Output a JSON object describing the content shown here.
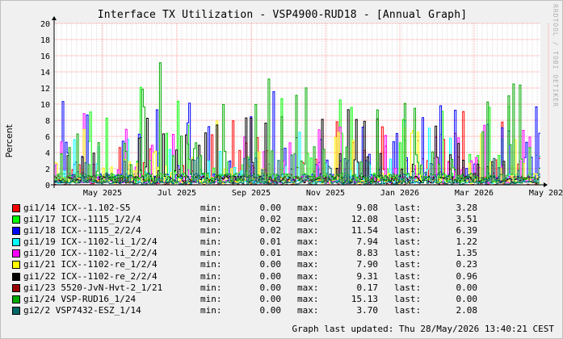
{
  "title": "Interface TX Utilization - VSP4900-RUD18 - [Annual Graph]",
  "watermark": "RRDTOOL / TOBI OETIKER",
  "ylabel": "Percent",
  "footer": "Graph last updated: Thu 28/May/2026 13:40:21 CEST",
  "colors": {
    "background": "#f0f0f0",
    "plot": "#ffffff",
    "grid_major": "#ff9999",
    "grid_minor": "#dddddd"
  },
  "legend_labels": {
    "min": "min:",
    "max": "max:",
    "last": "last:"
  },
  "chart_data": {
    "type": "line",
    "ylim": [
      0,
      20
    ],
    "y_ticks": [
      "0",
      "2",
      "4",
      "6",
      "8",
      "10",
      "12",
      "14",
      "16",
      "18",
      "20"
    ],
    "x_ticks": [
      "May 2025",
      "Jul 2025",
      "Sep 2025",
      "Nov 2025",
      "Jan 2026",
      "Mar 2026",
      "May 2026"
    ],
    "grid": true,
    "legend_position": "bottom",
    "series": [
      {
        "name": "gi1/14 ICX--1.102-S5",
        "color": "#ff0000",
        "min": "0.00",
        "max": "9.08",
        "last": "3.28"
      },
      {
        "name": "gi1/17 ICX--1115_1/2/4",
        "color": "#00ff00",
        "min": "0.02",
        "max": "12.08",
        "last": "3.51"
      },
      {
        "name": "gi1/18 ICX--1115_2/2/4",
        "color": "#0000ff",
        "min": "0.02",
        "max": "11.54",
        "last": "6.39"
      },
      {
        "name": "gi1/19 ICX--1102-li_1/2/4",
        "color": "#00ffff",
        "min": "0.01",
        "max": "7.94",
        "last": "1.22"
      },
      {
        "name": "gi1/20 ICX--1102-li_2/2/4",
        "color": "#ff00ff",
        "min": "0.01",
        "max": "8.83",
        "last": "1.35"
      },
      {
        "name": "gi1/21 ICX--1102-re_1/2/4",
        "color": "#ffff00",
        "min": "0.00",
        "max": "7.90",
        "last": "0.23"
      },
      {
        "name": "gi1/22 ICX--1102-re_2/2/4",
        "color": "#000000",
        "min": "0.00",
        "max": "9.31",
        "last": "0.96"
      },
      {
        "name": "gi1/23 5520-JvN-Hvt-2_1/21",
        "color": "#990000",
        "min": "0.00",
        "max": "0.17",
        "last": "0.00"
      },
      {
        "name": "gi1/24 VSP-RUD16_1/24",
        "color": "#00aa00",
        "min": "0.00",
        "max": "15.13",
        "last": "0.00"
      },
      {
        "name": "gi2/2 VSP7432-ESZ_1/14",
        "color": "#006666",
        "min": "0.00",
        "max": "3.70",
        "last": "2.08"
      }
    ]
  }
}
